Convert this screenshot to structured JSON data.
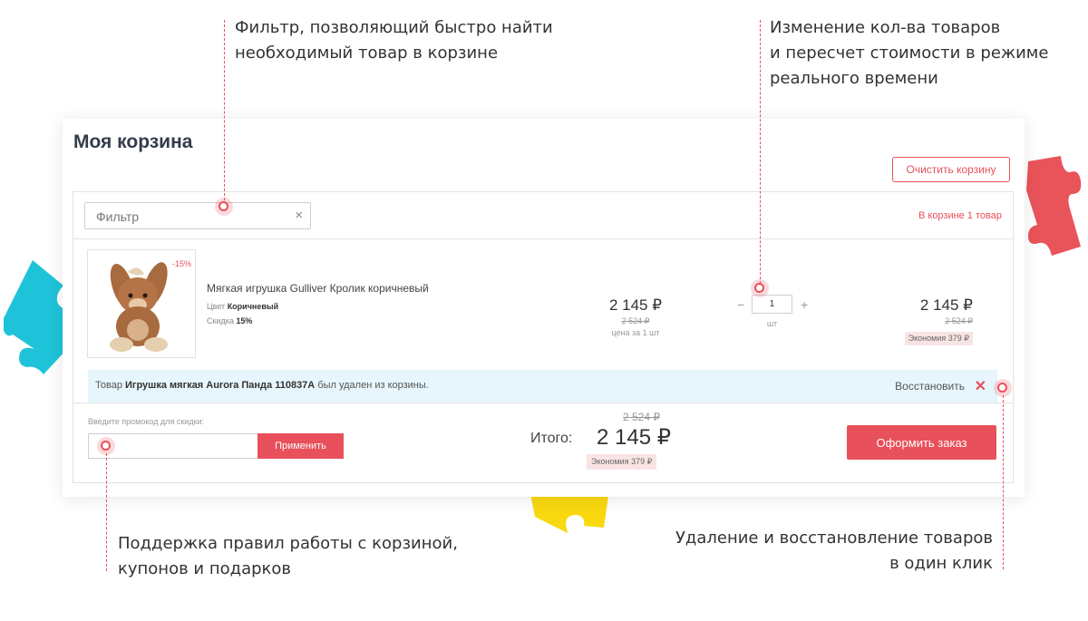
{
  "annotations": {
    "filter_note": [
      "Фильтр, позволяющий быстро найти",
      "необходимый товар в корзине"
    ],
    "quantity_note": [
      "Изменение кол-ва товаров",
      "и пересчет стоимости в режиме",
      "реального времени"
    ],
    "rules_note": [
      "Поддержка правил работы с корзиной,",
      "купонов и подарков"
    ],
    "restore_note": [
      "Удаление и восстановление товаров",
      "в один клик"
    ]
  },
  "cart": {
    "title": "Моя корзина",
    "clear_button": "Очистить корзину",
    "filter_placeholder": "Фильтр",
    "filter_clear": "×",
    "count_label": "В корзине 1 товар",
    "item": {
      "discount_badge": "-15%",
      "name": "Мягкая игрушка Gulliver Кролик коричневый",
      "color_label": "Цвет",
      "color_value": "Коричневый",
      "discount_label": "Скидка",
      "discount_value": "15%",
      "price": "2 145 ₽",
      "old_price": "2 524 ₽",
      "price_note": "цена за 1 шт",
      "quantity": "1",
      "quantity_unit": "шт",
      "minus": "−",
      "plus": "+",
      "total": "2 145 ₽",
      "total_old": "2 524 ₽",
      "economy": "Экономия 379 ₽"
    },
    "removed_notice": {
      "prefix": "Товар",
      "product": "Игрушка мягкая Aurora Панда 110837A",
      "suffix": "был удален из корзины.",
      "restore": "Восстановить",
      "close": "✕"
    },
    "promo": {
      "label": "Введите промокод для скидки:",
      "value": "",
      "apply": "Применить"
    },
    "summary": {
      "label": "Итого:",
      "old_total": "2 524 ₽",
      "total": "2 145 ₽",
      "economy": "Экономия 379 ₽",
      "checkout": "Оформить заказ"
    }
  },
  "colors": {
    "accent": "#e8505b",
    "notice_bg": "#e6f6fc",
    "puzzle_red": "#e9545a",
    "puzzle_cyan": "#1fc3d9",
    "puzzle_yellow": "#f8d90f"
  }
}
